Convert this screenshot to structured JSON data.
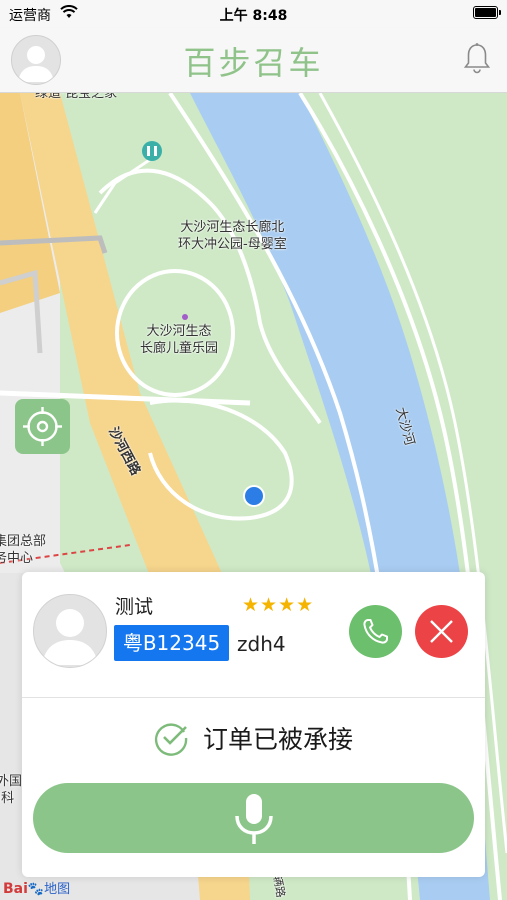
{
  "status_bar": {
    "carrier": "运营商",
    "time": "上午 8:48"
  },
  "nav": {
    "title": "百步召车",
    "avatar_icon": "user-avatar-icon",
    "bell_icon": "bell-icon"
  },
  "map": {
    "labels": {
      "top_partial": "绿道·昆宝之家",
      "poi_north": "大沙河生态长廊北\n环大冲公园-母婴室",
      "poi_playground": "大沙河生态\n长廊儿童乐园",
      "river": "大沙河",
      "road_west": "沙河西路",
      "building_left": "集团总部\n务中心",
      "building_left_lower": "外国\n)科",
      "road_bottom": "辆路"
    },
    "logo": {
      "text": "Bai",
      "suffix": "地图"
    },
    "colors": {
      "water": "#a9cdf2",
      "park": "#cbe8c3",
      "road": "#f6d58c",
      "location_dot": "#2c7de6"
    }
  },
  "driver_card": {
    "name": "测试",
    "rating": 4,
    "rating_stars": "★★★★",
    "plate": "粤B12345",
    "car_model": "zdh4",
    "call_icon": "phone-icon",
    "cancel_icon": "close-icon"
  },
  "order": {
    "status": "订单已被承接",
    "status_icon": "check-circle-icon"
  },
  "voice": {
    "icon": "microphone-icon"
  },
  "colors": {
    "accent": "#8cc58a",
    "call": "#6cbf6c",
    "cancel": "#ec4446",
    "plate": "#1477f0",
    "star": "#f5b400"
  }
}
